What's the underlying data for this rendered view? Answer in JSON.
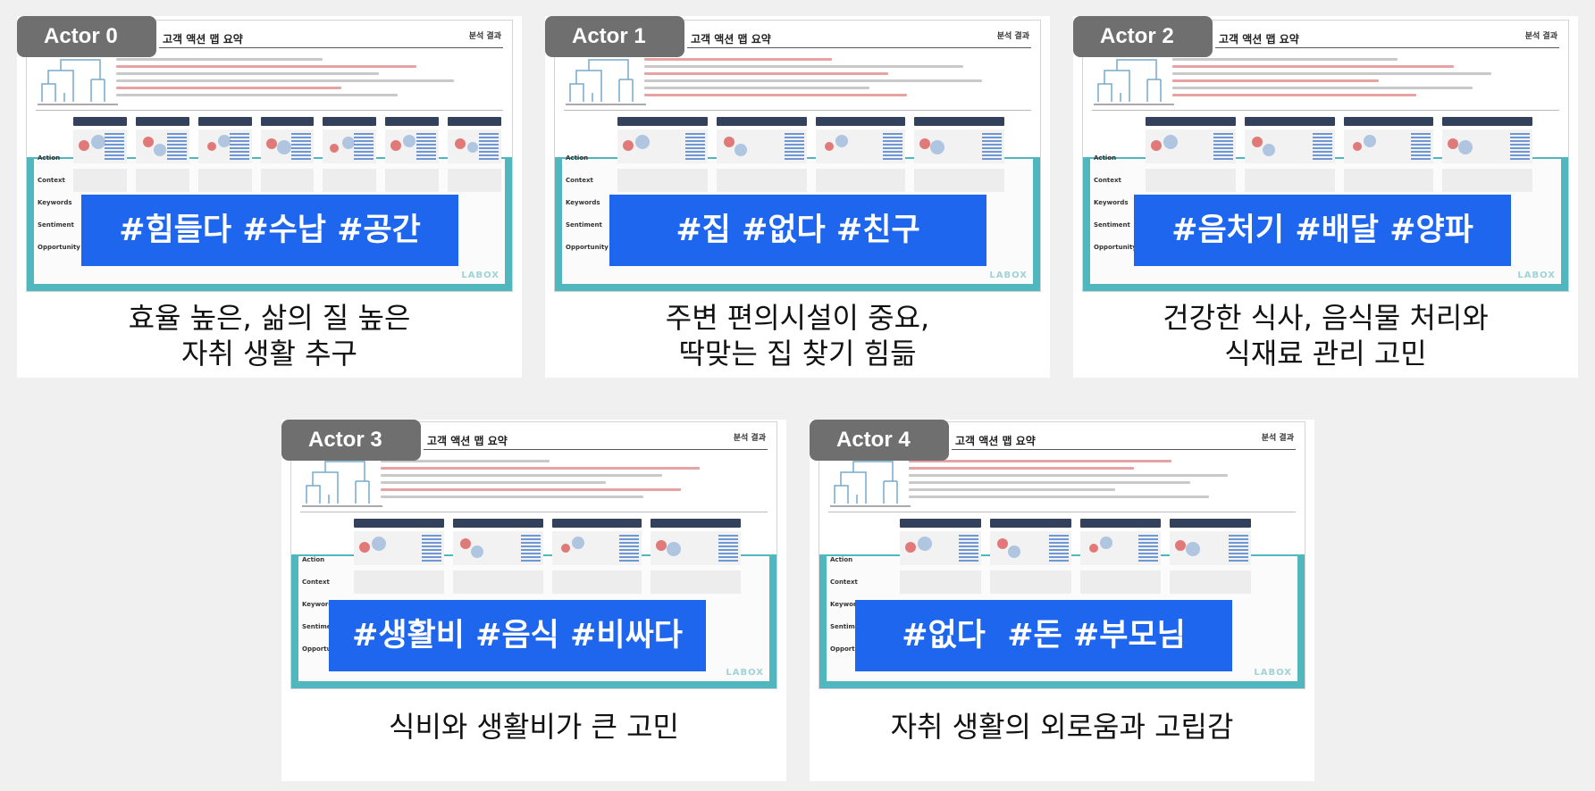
{
  "colors": {
    "badge": "#6f6f6f",
    "hashtag_bg": "#1f66ee",
    "frame": "#4fb7bd"
  },
  "slide_common": {
    "title": "고객 액션 맵 요약",
    "tag": "분석 결과",
    "row_labels": [
      "Action",
      "Context",
      "Keywords",
      "Sentiment",
      "Opportunity"
    ],
    "logo": "LABOX"
  },
  "cards": [
    {
      "actor": "Actor 0",
      "hashtags": "#힘들다 #수납 #공간",
      "caption_line1": "효율 높은, 삶의 질 높은",
      "caption_line2": "자취 생활 추구"
    },
    {
      "actor": "Actor 1",
      "hashtags": "#집 #없다 #친구",
      "caption_line1": "주변 편의시설이 중요,",
      "caption_line2": "딱맞는 집 찾기 힘듦"
    },
    {
      "actor": "Actor 2",
      "hashtags": "#음처기 #배달 #양파",
      "caption_line1": "건강한 식사, 음식물 처리와",
      "caption_line2": "식재료 관리 고민"
    },
    {
      "actor": "Actor 3",
      "hashtags": "#생활비 #음식 #비싸다",
      "caption_line1": "식비와 생활비가 큰 고민",
      "caption_line2": ""
    },
    {
      "actor": "Actor 4",
      "hashtags": "#없다  #돈 #부모님",
      "caption_line1": "자취 생활의 외로움과 고립감",
      "caption_line2": ""
    }
  ]
}
